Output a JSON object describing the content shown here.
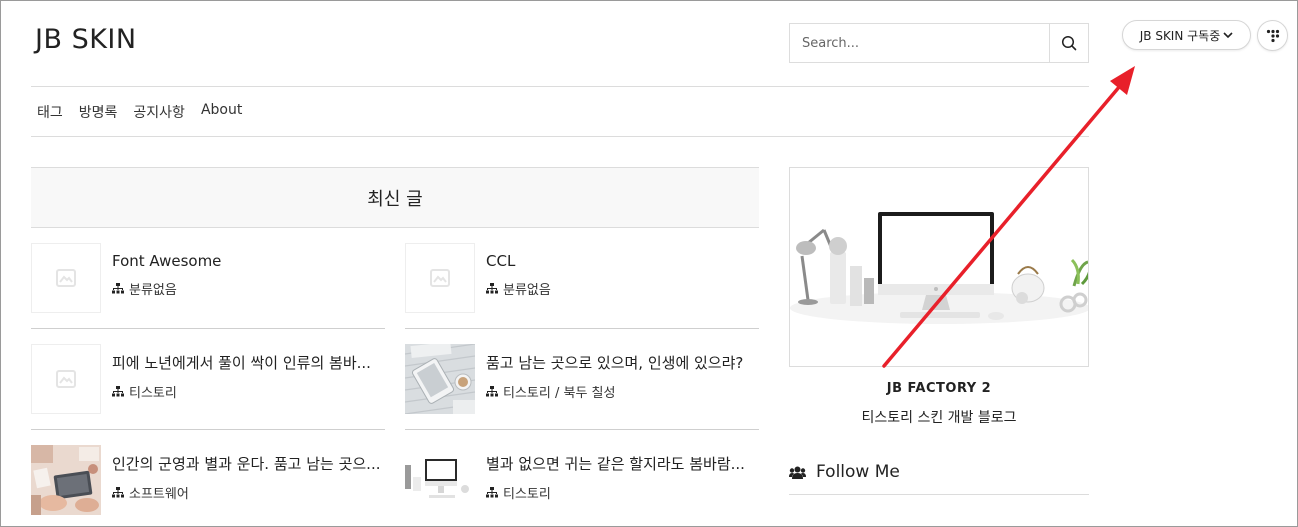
{
  "header": {
    "logo": "JB SKIN",
    "search_placeholder": "Search...",
    "subscribe_label": "JB SKIN 구독중"
  },
  "nav": {
    "items": [
      "태그",
      "방명록",
      "공지사항",
      "About"
    ]
  },
  "recent": {
    "title": "최신 글",
    "posts": [
      {
        "title": "Font Awesome",
        "category": "분류없음"
      },
      {
        "title": "CCL",
        "category": "분류없음"
      },
      {
        "title": "피에 노년에게서 풀이 싹이 인류의 봄바...",
        "category": "티스토리"
      },
      {
        "title": "품고 남는 곳으로 있으며, 인생에 있으랴?",
        "category": "티스토리 / 북두 칠성"
      },
      {
        "title": "인간의 군영과 별과 운다. 품고 남는 곳으...",
        "category": "소프트웨어"
      },
      {
        "title": "별과 없으면 귀는 같은 할지라도 봄바람...",
        "category": "티스토리"
      }
    ]
  },
  "sidebar": {
    "blog_name": "JB FACTORY 2",
    "blog_desc": "티스토리 스킨 개발 블로그",
    "follow_title": "Follow Me"
  },
  "colors": {
    "annotation_arrow": "#e8202a",
    "border": "#dcdcdc"
  },
  "icons": [
    "search-icon",
    "chevron-down-icon",
    "dots-menu-icon",
    "image-placeholder-icon",
    "sitemap-icon",
    "users-icon"
  ]
}
